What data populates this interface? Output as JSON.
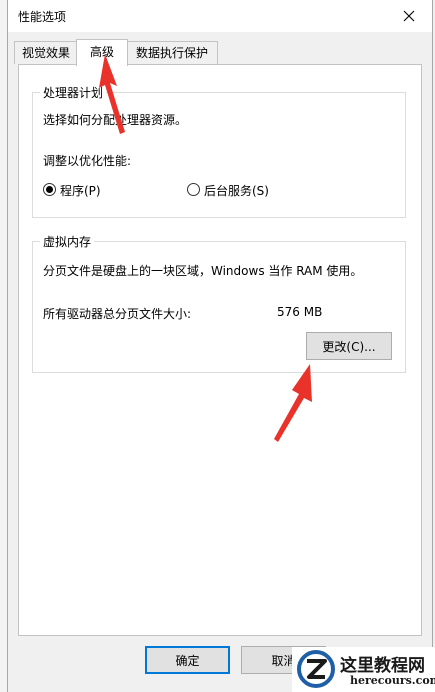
{
  "window": {
    "title": "性能选项"
  },
  "tabs": [
    {
      "label": "视觉效果"
    },
    {
      "label": "高级"
    },
    {
      "label": "数据执行保护"
    }
  ],
  "processor": {
    "group_title": "处理器计划",
    "description": "选择如何分配处理器资源。",
    "adjust_label": "调整以优化性能:",
    "option_programs": "程序(P)",
    "option_services": "后台服务(S)",
    "selected": "programs"
  },
  "virtual_memory": {
    "group_title": "虚拟内存",
    "description": "分页文件是硬盘上的一块区域，Windows 当作 RAM 使用。",
    "total_label": "所有驱动器总分页文件大小:",
    "total_value": "576 MB",
    "change_button": "更改(C)..."
  },
  "footer": {
    "ok_button": "确定",
    "cancel_button": "取消"
  },
  "watermark": {
    "title": "这里教程网",
    "url": "herecours.com"
  },
  "colors": {
    "accent": "#0078d7",
    "annotation": "#e8322a"
  }
}
